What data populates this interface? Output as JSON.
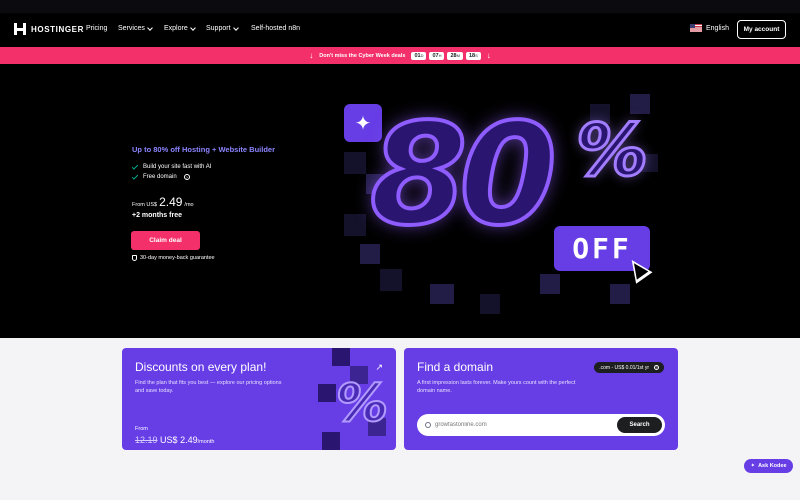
{
  "nav": {
    "brand": "HOSTINGER",
    "links": [
      {
        "label": "Pricing",
        "dropdown": false
      },
      {
        "label": "Services",
        "dropdown": true
      },
      {
        "label": "Explore",
        "dropdown": true
      },
      {
        "label": "Support",
        "dropdown": true
      },
      {
        "label": "Self-hosted n8n",
        "dropdown": false
      }
    ],
    "language": "English",
    "account": "My account"
  },
  "promo": {
    "text": "Don't miss the Cyber Week deals",
    "timer": [
      {
        "value": "01",
        "unit": "D"
      },
      {
        "value": "07",
        "unit": "H"
      },
      {
        "value": "28",
        "unit": "M"
      },
      {
        "value": "18",
        "unit": "S"
      }
    ],
    "color": "#f4306b"
  },
  "hero": {
    "title": "Up to 80% off Hosting + Website Builder",
    "features": [
      "Build your site fast with AI",
      "Free domain"
    ],
    "price_prefix": "From US$",
    "price": "2.49",
    "price_suffix": "/mo",
    "bonus": "+2 months free",
    "cta": "Claim deal",
    "guarantee": "30-day money-back guarantee",
    "art": {
      "big_number": "80",
      "percent": "%",
      "badge": "OFF"
    }
  },
  "cards": {
    "discounts": {
      "title": "Discounts on every plan!",
      "text": "Find the plan that fits you best — explore our pricing options and save today.",
      "from": "From",
      "old_price": "12.19",
      "currency": "US$",
      "price": "2.49",
      "period": "/month"
    },
    "domain": {
      "title": "Find a domain",
      "text": "A first impression lasts forever. Make yours count with the perfect domain name.",
      "tld_badge": ".com - US$ 0.01/1st yr",
      "search_placeholder": "growfastonline.com",
      "search_button": "Search"
    }
  },
  "assistant": {
    "label": "Ask Kodee"
  },
  "colors": {
    "accent": "#673de6",
    "promo": "#f4306b",
    "hero_title": "#8c85ff"
  }
}
